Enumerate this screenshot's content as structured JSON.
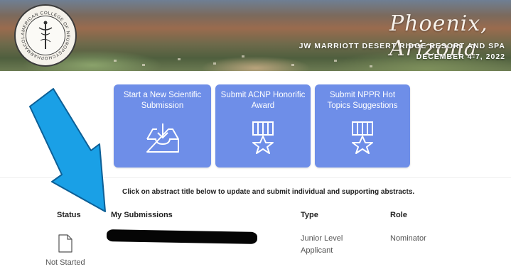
{
  "banner": {
    "city": "Phoenix, Arizona",
    "venue": "JW MARRIOTT DESERT RIDGE RESORT AND SPA",
    "dates": "DECEMBER 4-7, 2022",
    "seal_text": "AMERICAN COLLEGE OF NEUROPSYCHOPHARMACOLOGY INC."
  },
  "actions": [
    {
      "label": "Start a New Scientific Submission",
      "icon": "inbox-download-icon"
    },
    {
      "label": "Submit ACNP Honorific Award",
      "icon": "award-ribbon-icon"
    },
    {
      "label": "Submit NPPR Hot Topics Suggestions",
      "icon": "award-ribbon-icon"
    }
  ],
  "instruction": "Click on abstract title below to update and submit individual and supporting abstracts.",
  "table": {
    "headers": {
      "status": "Status",
      "submissions": "My Submissions",
      "type": "Type",
      "role": "Role"
    },
    "rows": [
      {
        "status": "Not Started",
        "title": "",
        "type": "Junior Level Applicant",
        "role": "Nominator"
      }
    ]
  },
  "colors": {
    "tile": "#6e8ee8",
    "annotation_arrow": "#1aa0e6"
  }
}
